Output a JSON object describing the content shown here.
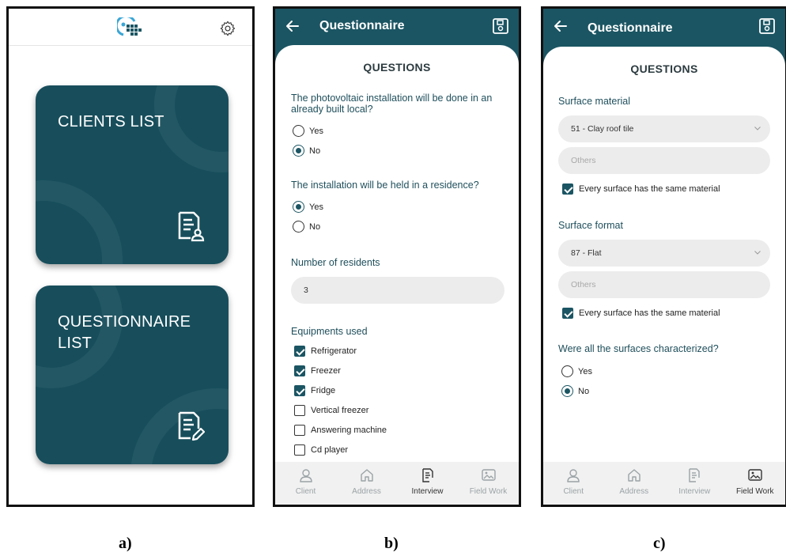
{
  "captions": {
    "a": "a)",
    "b": "b)",
    "c": "c)"
  },
  "colors": {
    "primary": "#1b5563",
    "card": "#184e5c",
    "pill": "#ececec"
  },
  "screen_a": {
    "icons": {
      "logo": "grid-sun-logo",
      "settings": "gear-icon"
    },
    "cards": [
      {
        "title": "CLIENTS LIST",
        "icon": "client-document-icon"
      },
      {
        "title": "QUESTIONNAIRE LIST",
        "icon": "edit-document-icon"
      }
    ]
  },
  "screen_b": {
    "title": "Questionnaire",
    "heading": "QUESTIONS",
    "q1": {
      "text": "The photovoltaic installation will be done in an already built local?",
      "options": [
        "Yes",
        "No"
      ],
      "selected": "No"
    },
    "q2": {
      "text": "The installation will be held in a residence?",
      "options": [
        "Yes",
        "No"
      ],
      "selected": "Yes"
    },
    "residents": {
      "label": "Number of residents",
      "value": "3"
    },
    "equipments": {
      "label": "Equipments used",
      "items": [
        {
          "label": "Refrigerator",
          "checked": true
        },
        {
          "label": "Freezer",
          "checked": true
        },
        {
          "label": "Fridge",
          "checked": true
        },
        {
          "label": "Vertical freezer",
          "checked": false
        },
        {
          "label": "Answering machine",
          "checked": false
        },
        {
          "label": "Cd player",
          "checked": false
        }
      ]
    },
    "nav": [
      {
        "label": "Client",
        "icon": "person-icon"
      },
      {
        "label": "Address",
        "icon": "home-icon"
      },
      {
        "label": "Interview",
        "icon": "document-icon",
        "active": true
      },
      {
        "label": "Field Work",
        "icon": "image-edit-icon"
      }
    ]
  },
  "screen_c": {
    "title": "Questionnaire",
    "heading": "QUESTIONS",
    "surface_material": {
      "label": "Surface material",
      "value": "51 - Clay roof tile",
      "others_placeholder": "Others",
      "same_label": "Every surface has the same material",
      "same_checked": true
    },
    "surface_format": {
      "label": "Surface format",
      "value": "87 - Flat",
      "others_placeholder": "Others",
      "same_label": "Every surface has the same material",
      "same_checked": true
    },
    "characterized": {
      "text": "Were all the surfaces characterized?",
      "options": [
        "Yes",
        "No"
      ],
      "selected": "No"
    },
    "nav": [
      {
        "label": "Client",
        "icon": "person-icon"
      },
      {
        "label": "Address",
        "icon": "home-icon"
      },
      {
        "label": "Interview",
        "icon": "document-icon"
      },
      {
        "label": "Field Work",
        "icon": "image-edit-icon",
        "active": true
      }
    ]
  }
}
